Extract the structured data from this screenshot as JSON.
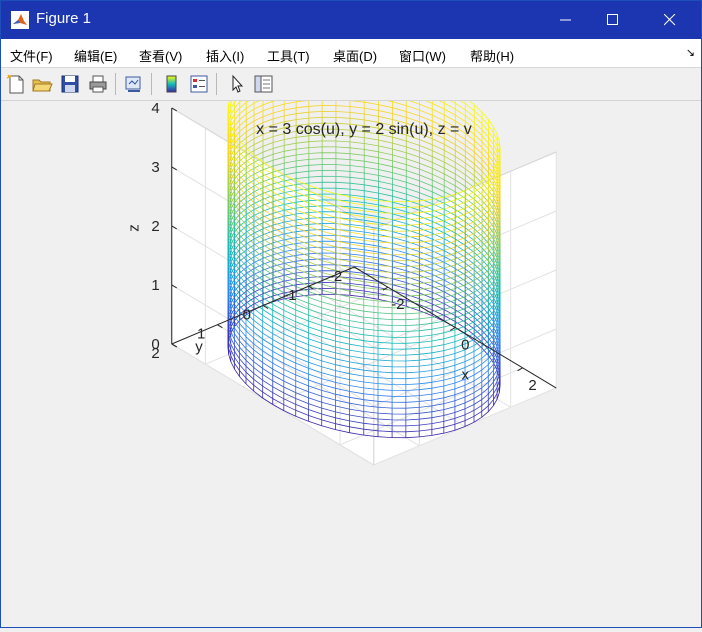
{
  "window": {
    "title": "Figure 1"
  },
  "menu": [
    {
      "label": "文件(F)"
    },
    {
      "label": "编辑(E)"
    },
    {
      "label": "查看(V)"
    },
    {
      "label": "插入(I)"
    },
    {
      "label": "工具(T)"
    },
    {
      "label": "桌面(D)"
    },
    {
      "label": "窗口(W)"
    },
    {
      "label": "帮助(H)"
    }
  ],
  "menu_overflow": "↘",
  "toolbar": [
    "new-figure-icon",
    "open-file-icon",
    "save-icon",
    "print-icon",
    "link-plot-icon",
    "insert-colorbar-icon",
    "insert-legend-icon",
    "edit-plot-icon",
    "property-inspector-icon"
  ],
  "chart_data": {
    "type": "surface-mesh",
    "title": "x = 3 cos(u), y = 2 sin(u), z = v",
    "xlabel": "x",
    "ylabel": "y",
    "zlabel": "z",
    "x_ticks": [
      "-2",
      "0",
      "2"
    ],
    "y_ticks": [
      "-2",
      "-1",
      "0",
      "1",
      "2"
    ],
    "z_ticks": [
      "0",
      "1",
      "2",
      "3",
      "4"
    ],
    "xlim": [
      -3,
      3
    ],
    "ylim": [
      -2,
      2
    ],
    "zlim": [
      0,
      4
    ],
    "grid": true,
    "colormap": "parula",
    "colormap_colors": [
      "#3e26a8",
      "#2e87f7",
      "#12bdb9",
      "#82cb66",
      "#f9d326",
      "#f9fb0e"
    ],
    "surface": {
      "x": "3*cos(u)",
      "y": "2*sin(u)",
      "z": "v"
    }
  }
}
